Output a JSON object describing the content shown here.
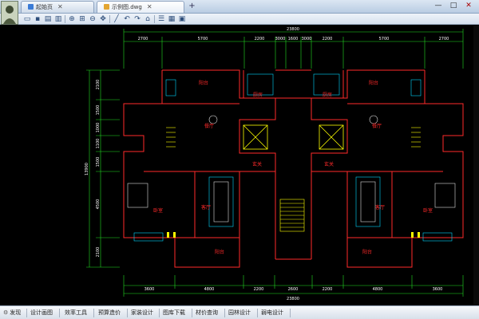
{
  "tabs": [
    {
      "label": "起始页"
    },
    {
      "label": "示例图.dwg"
    }
  ],
  "window_controls": {
    "minimize": "—",
    "maximize": "□",
    "close": "✕"
  },
  "toolbar_icons": [
    "open-icon",
    "save-icon",
    "print-icon",
    "print-preview-icon",
    "zoom-window-icon",
    "zoom-extents-icon",
    "zoom-realtime-icon",
    "pan-icon",
    "line-icon",
    "undo-icon",
    "redo-icon",
    "measure-icon",
    "layer-icon",
    "text-icon",
    "properties-icon"
  ],
  "colors": {
    "background": "#000000",
    "wall": "#ff2a2a",
    "dimension": "#22dd22",
    "text_dimension": "#ffffff",
    "fixture": "#00d8ff",
    "stair": "#ffff00",
    "window": "#00c8ff"
  },
  "drawing": {
    "top_total": "23800",
    "top_dims": [
      "2700",
      "5700",
      "2200",
      "3000",
      "1600",
      "3000",
      "2200",
      "5700",
      "2700"
    ],
    "bottom_dims": [
      "3600",
      "4800",
      "2200",
      "2600",
      "2200",
      "4800",
      "3600"
    ],
    "bottom_total": "23800",
    "left_total": "13900",
    "left_dims": [
      "2100",
      "1500",
      "1000",
      "1100",
      "1500",
      "4500",
      "2100"
    ],
    "rooms": [
      "阳台",
      "厨房",
      "餐厅",
      "玄关",
      "客厅",
      "卧室",
      "阳台",
      "厨房",
      "餐厅",
      "玄关",
      "客厅",
      "卧室",
      "阳台",
      "阳台"
    ]
  },
  "bottom_menu": [
    "发现",
    "设计画图",
    "效率工具",
    "预算造价",
    "家装设计",
    "图库下载",
    "材价查询",
    "园林设计",
    "弱电设计"
  ]
}
